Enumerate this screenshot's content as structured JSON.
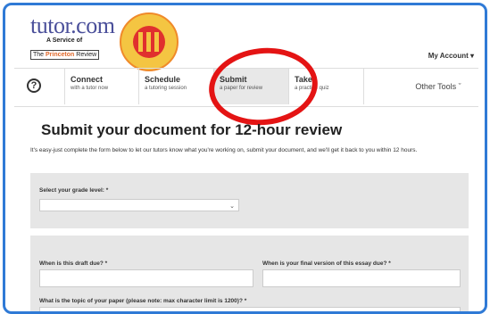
{
  "brand": {
    "logo_text": "tutor.com",
    "tagline": "A Service of",
    "pr_prefix": "The ",
    "pr_brand": "Princeton",
    "pr_suffix": " Review"
  },
  "header": {
    "account_label": "My Account ▾"
  },
  "nav": {
    "help_symbol": "?",
    "items": [
      {
        "title": "Connect",
        "subtitle": "with a tutor now"
      },
      {
        "title": "Schedule",
        "subtitle": "a tutoring session"
      },
      {
        "title": "Submit",
        "subtitle": "a paper for review"
      },
      {
        "title": "Take",
        "subtitle": "a practice quiz"
      }
    ],
    "other_tools": "Other Tools ˇ"
  },
  "page": {
    "title": "Submit your document for 12-hour review",
    "intro": "It's easy-just complete the form below to let our tutors know what you're working on, submit your document, and we'll get it back to you within 12 hours."
  },
  "form": {
    "grade_label": "Select your grade level: *",
    "grade_value": "",
    "draft_due_label": "When is this draft due? *",
    "final_due_label": "When is your final version of this essay due? *",
    "topic_label": "What is the topic of your paper (please note: max character limit is 1200)? *"
  },
  "colors": {
    "frame": "#2f7ad6",
    "annotation": "#e41414",
    "logo": "#4a4f9a"
  }
}
